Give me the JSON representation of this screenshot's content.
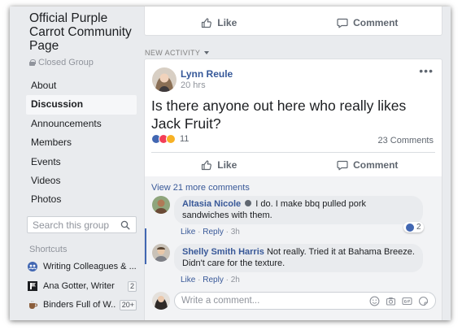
{
  "group": {
    "title": "Official Purple Carrot Community Page",
    "privacy": "Closed Group"
  },
  "nav": [
    {
      "label": "About",
      "active": false
    },
    {
      "label": "Discussion",
      "active": true
    },
    {
      "label": "Announcements",
      "active": false
    },
    {
      "label": "Members",
      "active": false
    },
    {
      "label": "Events",
      "active": false
    },
    {
      "label": "Videos",
      "active": false
    },
    {
      "label": "Photos",
      "active": false
    }
  ],
  "search": {
    "placeholder": "Search this group"
  },
  "shortcuts": {
    "heading": "Shortcuts",
    "items": [
      {
        "label": "Writing Colleagues & ...",
        "count": "",
        "icon": "group-icon"
      },
      {
        "label": "Ana Gotter, Writer",
        "count": "2",
        "icon": "page-flag-icon"
      },
      {
        "label": "Binders Full of W...",
        "count": "20+",
        "icon": "coffee-icon"
      }
    ]
  },
  "actions": {
    "like": "Like",
    "comment": "Comment"
  },
  "feed": {
    "new_activity": "NEW ACTIVITY"
  },
  "post": {
    "author": "Lynn Reule",
    "time": "20 hrs",
    "text": "Is there anyone out here who really likes Jack Fruit?",
    "reaction_count": "11",
    "comment_count": "23 Comments",
    "view_more": "View 21 more comments"
  },
  "comments": [
    {
      "author": "Altasia Nicole",
      "text": "I do. I make bbq pulled pork sandwiches with them.",
      "like": "Like",
      "reply": "Reply",
      "time": "3h",
      "reaction_count": "2"
    },
    {
      "author": "Shelly Smith Harris",
      "text": "Not really. Tried it at Bahama Breeze. Didn't care for the texture.",
      "like": "Like",
      "reply": "Reply",
      "time": "2h"
    }
  ],
  "composer": {
    "placeholder": "Write a comment..."
  },
  "colors": {
    "link": "#385898",
    "like_blue": "#4267b2",
    "love_red": "#f33e58",
    "haha_yellow": "#f7b125",
    "page_bg": "#e9ebee"
  }
}
